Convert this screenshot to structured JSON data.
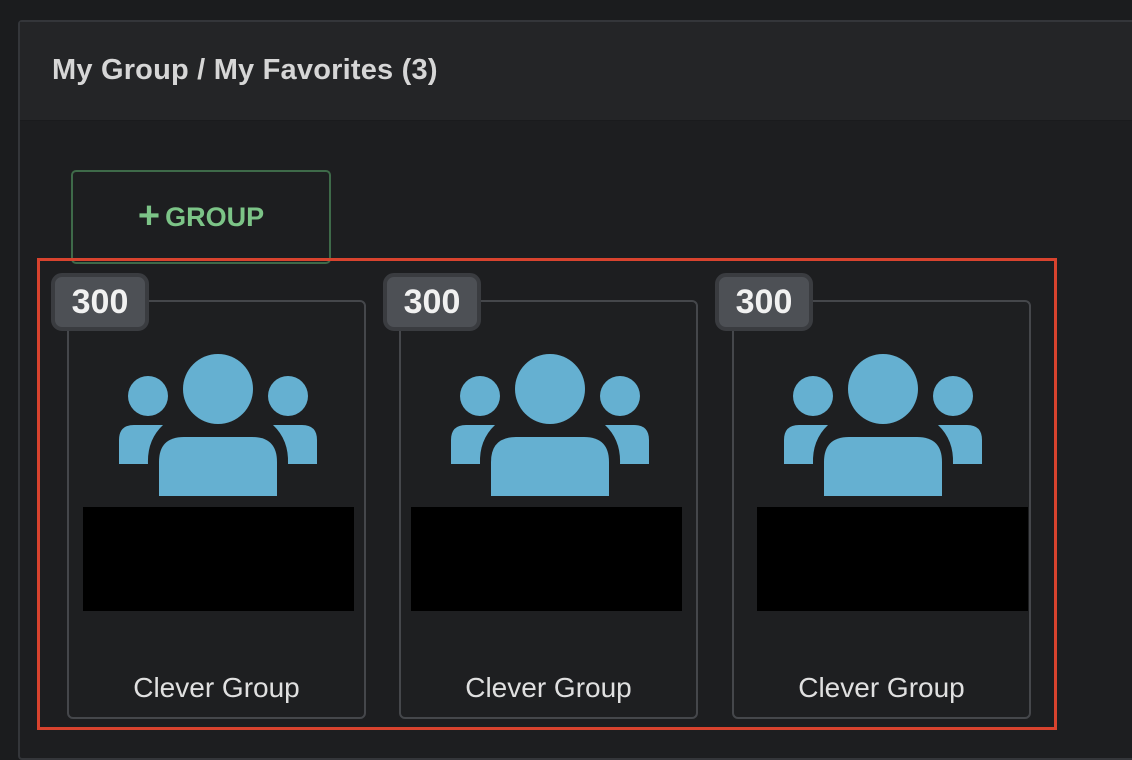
{
  "panel": {
    "title": "My Group / My Favorites (3)"
  },
  "add_group_button": {
    "icon": "plus-icon",
    "label": "GROUP"
  },
  "colors": {
    "icon_blue": "#65b0d1",
    "button_green": "#7cc487",
    "highlight_red": "#d8432e"
  },
  "groups": [
    {
      "count": "300",
      "icon": "group-icon",
      "name": "Clever Group"
    },
    {
      "count": "300",
      "icon": "group-icon",
      "name": "Clever Group"
    },
    {
      "count": "300",
      "icon": "group-icon",
      "name": "Clever Group"
    }
  ]
}
